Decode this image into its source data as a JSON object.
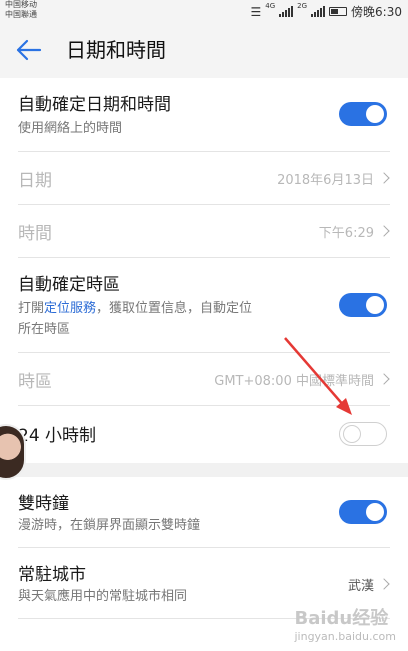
{
  "status": {
    "carrier1": "中国移动",
    "carrier2": "中国聯通",
    "net1": "4G",
    "net2": "2G",
    "time": "傍晚6:30"
  },
  "header": {
    "title": "日期和時間"
  },
  "rows": {
    "auto_datetime": {
      "label": "自動確定日期和時間",
      "sub": "使用網絡上的時間",
      "toggle_on": true
    },
    "date": {
      "label": "日期",
      "value": "2018年6月13日"
    },
    "time": {
      "label": "時間",
      "value": "下午6:29"
    },
    "auto_timezone": {
      "label": "自動確定時區",
      "sub_before": "打開",
      "sub_link": "定位服務",
      "sub_after": "，獲取位置信息，自動定位",
      "sub_line2": "所在時區",
      "toggle_on": true
    },
    "timezone": {
      "label": "時區",
      "value": "GMT+08:00 中國標準時間"
    },
    "hour24": {
      "label": "24 小時制",
      "toggle_on": false
    },
    "dual_clock": {
      "label": "雙時鐘",
      "sub": "漫游時，在鎖屏界面顯示雙時鐘",
      "toggle_on": true
    },
    "home_city": {
      "label": "常駐城市",
      "sub": "與天氣應用中的常駐城市相同",
      "value": "武漢"
    }
  },
  "watermark": {
    "brand": "Baidu经验",
    "url": "jingyan.baidu.com"
  },
  "colors": {
    "accent": "#2a72e3",
    "link": "#2c6cd6",
    "annotation_arrow": "#e53935"
  }
}
